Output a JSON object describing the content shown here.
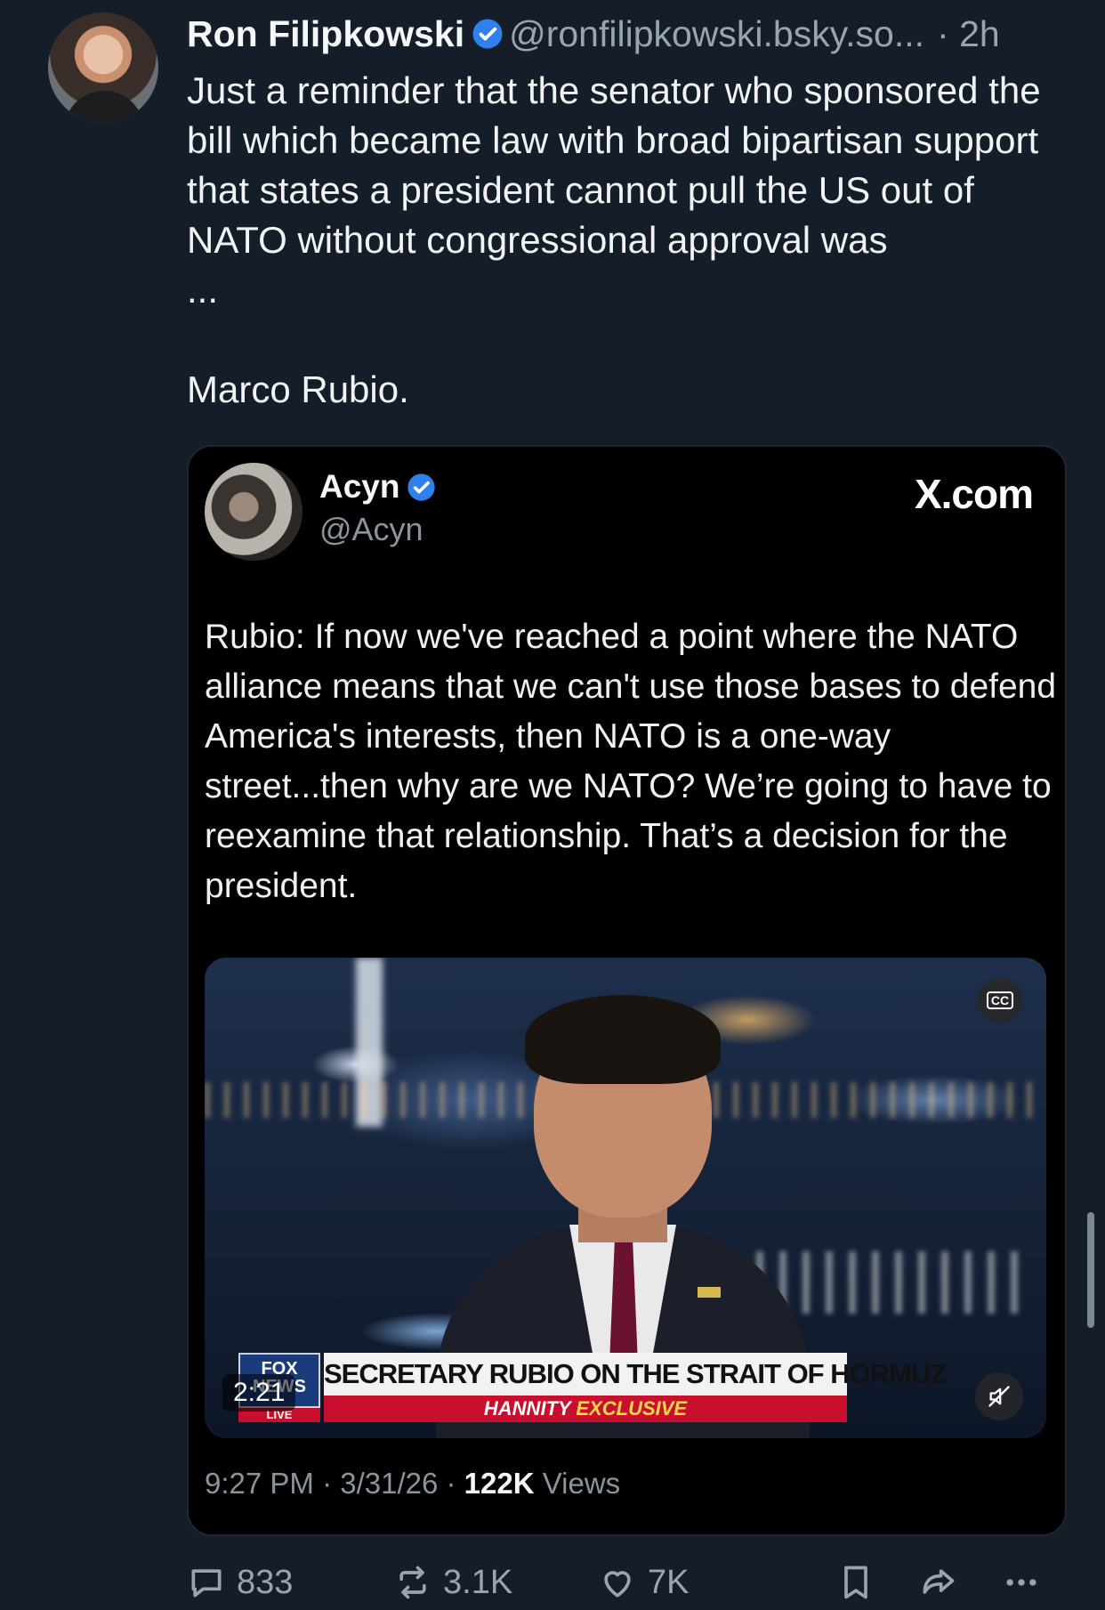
{
  "post": {
    "author_name": "Ron Filipkowski",
    "handle": "@ronfilipkowski.bsky.so...",
    "time": "· 2h",
    "text": "Just a reminder that the senator who sponsored the bill which became law with broad bipartisan support that states a president cannot pull the US out of NATO without congressional approval was\n...",
    "sign_off": "Marco Rubio."
  },
  "embed": {
    "author_name": "Acyn",
    "handle": "@Acyn",
    "source": "X.com",
    "text": "Rubio: If now we've reached a point where the NATO alliance means that we can't use those bases to defend America's interests, then NATO is a one-way street...then why are we NATO? We’re going to have to reexamine that relationship. That’s a decision for the president.",
    "video": {
      "duration": "2:21",
      "chyron_title": "SECRETARY RUBIO ON THE STRAIT OF HORMUZ",
      "chyron_sub_left": "HANNITY",
      "chyron_sub_right": "EXCLUSIVE",
      "network_logo": "FOX NEWS",
      "live_tag": "LIVE",
      "cc_label": "CC"
    },
    "time": "9:27 PM · 3/31/26 ·",
    "views_count": "122K",
    "views_label": "Views"
  },
  "actions": {
    "replies": "833",
    "reposts": "3.1K",
    "likes": "7K"
  },
  "icons": {
    "verified": "verified-badge-icon",
    "reply": "speech-bubble-icon",
    "repost": "repost-arrows-icon",
    "like": "heart-icon",
    "bookmark": "bookmark-icon",
    "share": "share-arrow-icon",
    "more": "ellipsis-icon",
    "mute": "muted-speaker-icon"
  },
  "colors": {
    "background": "#151d28",
    "embed_background": "#000000",
    "verified_blue": "#2f80ed",
    "muted_text": "#9aa4b0"
  }
}
